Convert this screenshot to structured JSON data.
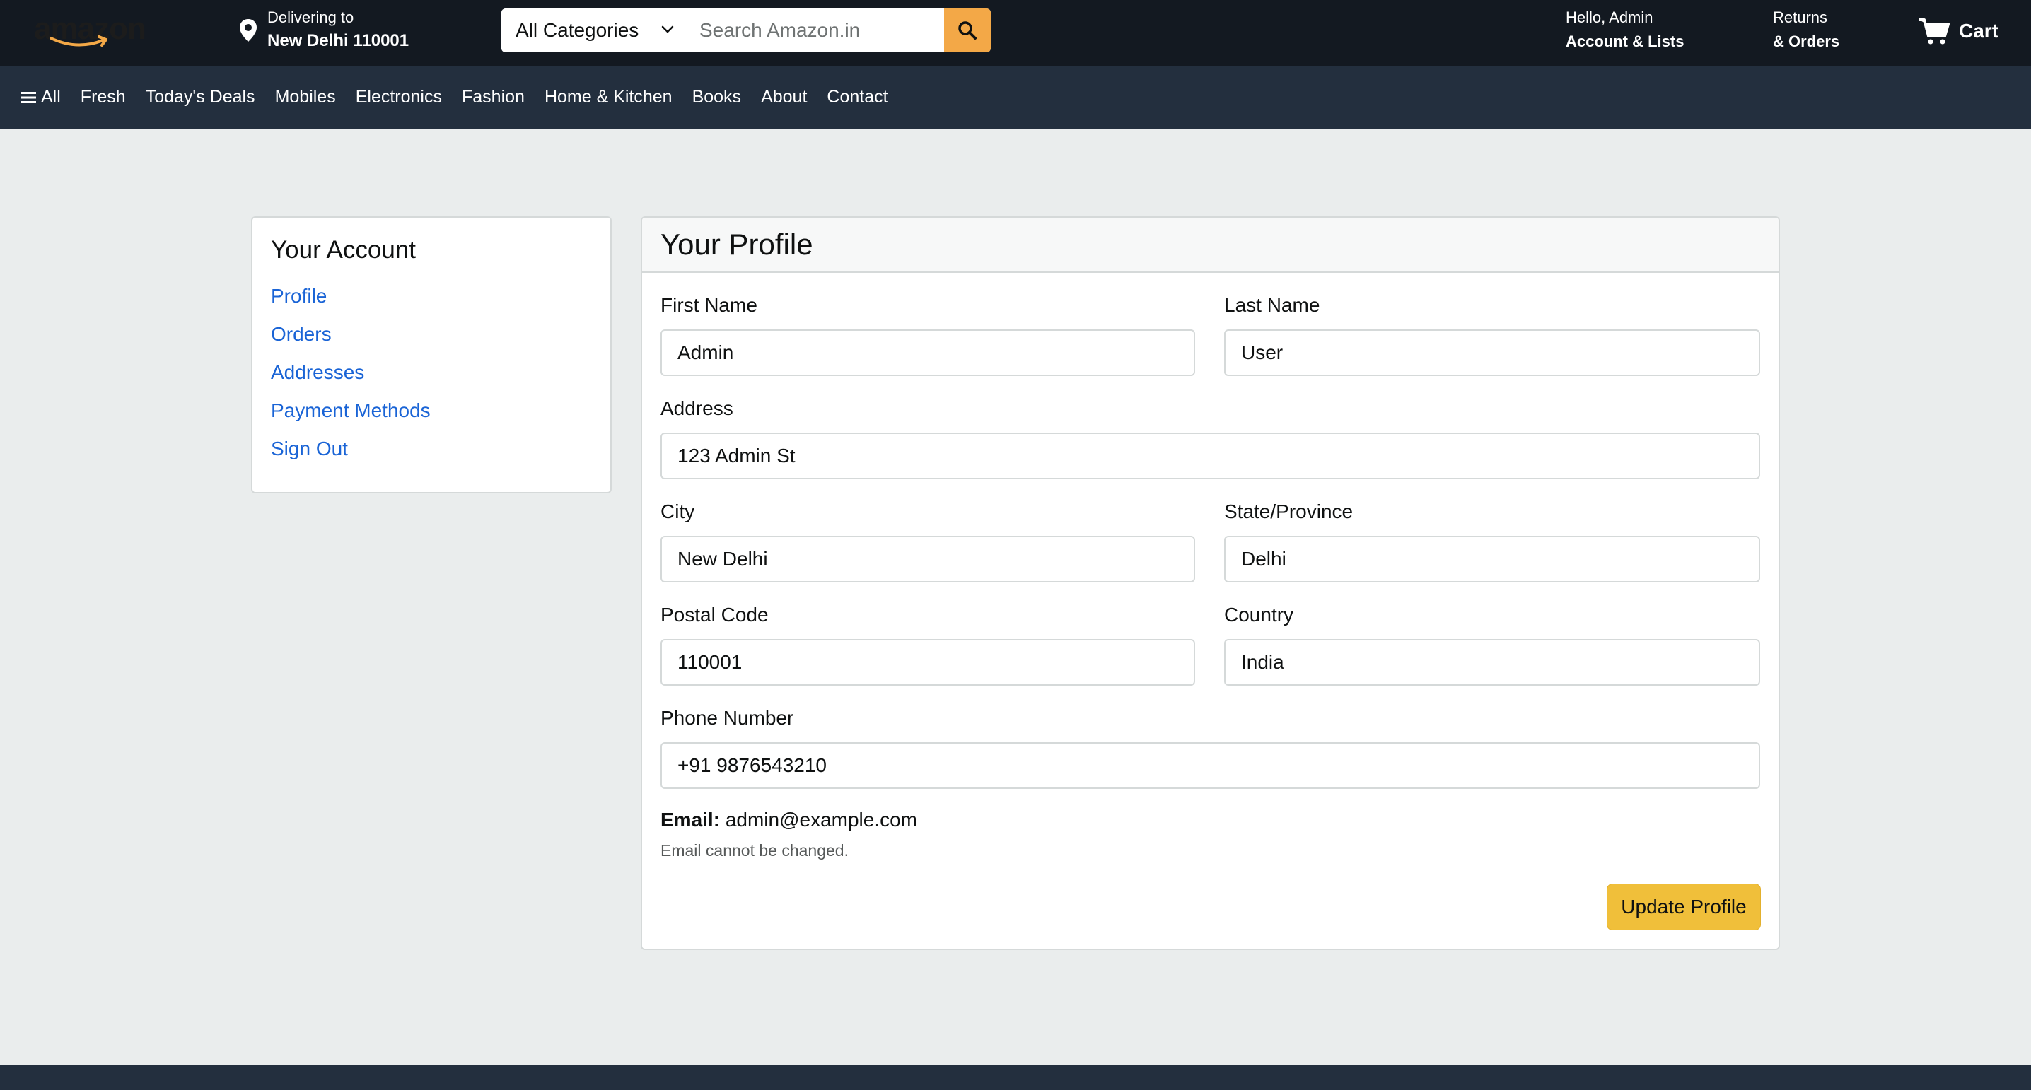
{
  "header": {
    "logo_text": "amazon",
    "deliver": {
      "line1": "Delivering to",
      "line2": "New Delhi 110001"
    },
    "search": {
      "category": "All Categories",
      "placeholder": "Search Amazon.in"
    },
    "account": {
      "line1": "Hello, Admin",
      "line2": "Account & Lists"
    },
    "orders": {
      "line1": "Returns",
      "line2": "& Orders"
    },
    "cart": {
      "label": "Cart"
    }
  },
  "nav": {
    "items": [
      "All",
      "Fresh",
      "Today's Deals",
      "Mobiles",
      "Electronics",
      "Fashion",
      "Home & Kitchen",
      "Books",
      "About",
      "Contact"
    ]
  },
  "sidebar": {
    "title": "Your Account",
    "links": [
      "Profile",
      "Orders",
      "Addresses",
      "Payment Methods",
      "Sign Out"
    ]
  },
  "profile": {
    "title": "Your Profile",
    "fields": {
      "first_name": {
        "label": "First Name",
        "value": "Admin"
      },
      "last_name": {
        "label": "Last Name",
        "value": "User"
      },
      "address": {
        "label": "Address",
        "value": "123 Admin St"
      },
      "city": {
        "label": "City",
        "value": "New Delhi"
      },
      "state": {
        "label": "State/Province",
        "value": "Delhi"
      },
      "postal_code": {
        "label": "Postal Code",
        "value": "110001"
      },
      "country": {
        "label": "Country",
        "value": "India"
      },
      "phone": {
        "label": "Phone Number",
        "value": "+91 9876543210"
      }
    },
    "email": {
      "label": "Email:",
      "value": "admin@example.com",
      "note": "Email cannot be changed."
    },
    "submit_label": "Update Profile"
  },
  "colors": {
    "header_bg": "#131921",
    "nav_bg": "#232f3e",
    "search_button": "#f3a847",
    "link": "#1a64d6",
    "update_button": "#f0bf3a",
    "page_bg": "#eaeded"
  },
  "icons": {
    "location": "location-pin-icon",
    "dropdown": "chevron-down-icon",
    "search": "search-icon",
    "cart": "cart-icon",
    "menu": "hamburger-menu-icon"
  }
}
